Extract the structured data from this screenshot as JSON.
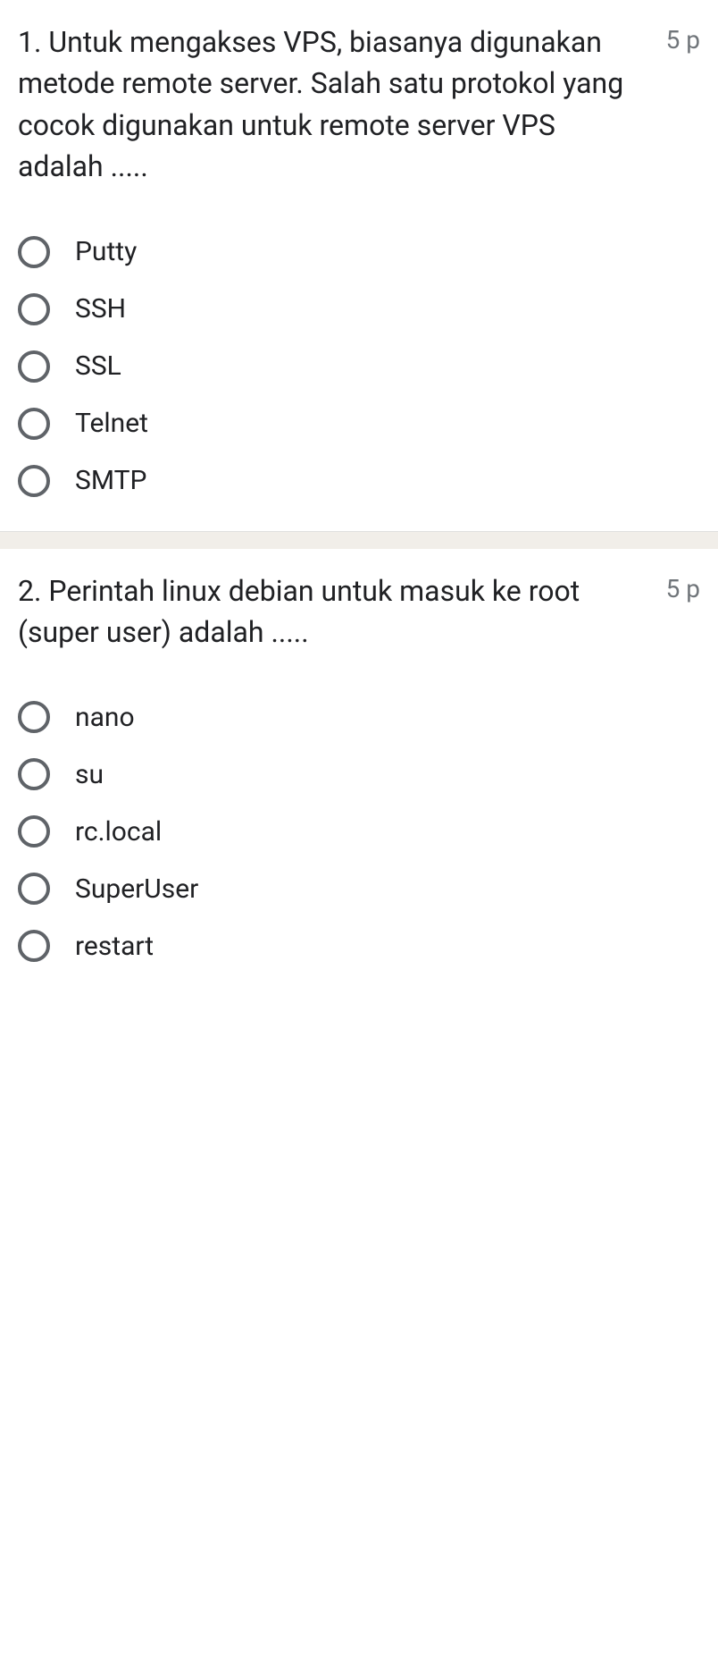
{
  "questions": [
    {
      "number": "1. ",
      "text": "Untuk mengakses VPS, biasanya digunakan metode remote server. Salah satu protokol yang cocok digunakan untuk remote server VPS adalah .....",
      "points": "5 p",
      "options": [
        "Putty",
        "SSH",
        "SSL",
        "Telnet",
        "SMTP"
      ]
    },
    {
      "number": "2. ",
      "text": "Perintah linux debian untuk masuk ke root (super user) adalah .....",
      "points": "5 p",
      "options": [
        "nano",
        "su",
        "rc.local",
        "SuperUser",
        "restart"
      ]
    }
  ]
}
